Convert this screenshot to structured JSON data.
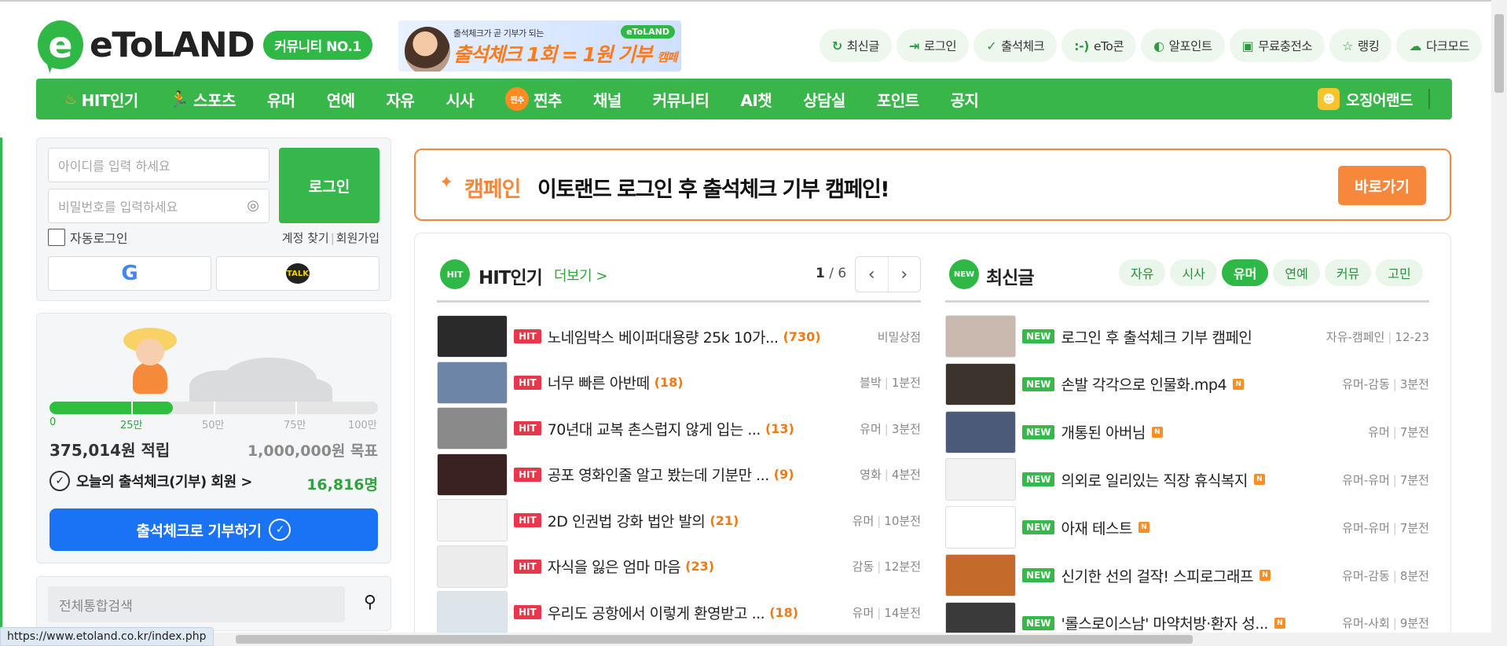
{
  "header": {
    "logo_mark": "e",
    "logo_text": "eToLAND",
    "badge": "커뮤니티 NO.1",
    "banner": {
      "sub": "출석체크가 곧 기부가 되는",
      "main_big": "출석체크 1회 = 1원 기부",
      "main_small": "캠페인",
      "tag": "eToLAND"
    },
    "quick_links": [
      {
        "icon": "refresh-icon",
        "glyph": "↻",
        "label": "최신글"
      },
      {
        "icon": "login-icon",
        "glyph": "⇥",
        "label": "로그인"
      },
      {
        "icon": "check-circle-icon",
        "glyph": "✓",
        "label": "출석체크"
      },
      {
        "icon": "eto-con-icon",
        "glyph": ":-)",
        "label": "eTo콘"
      },
      {
        "icon": "point-icon",
        "glyph": "◐",
        "label": "알포인트"
      },
      {
        "icon": "charge-station-icon",
        "glyph": "▣",
        "label": "무료충전소"
      },
      {
        "icon": "star-icon",
        "glyph": "☆",
        "label": "랭킹"
      },
      {
        "icon": "dark-mode-icon",
        "glyph": "☁",
        "label": "다크모드"
      }
    ]
  },
  "nav": {
    "items": [
      "HIT인기",
      "스포츠",
      "유머",
      "연예",
      "자유",
      "시사",
      "찐추",
      "채널",
      "커뮤니티",
      "AI챗",
      "상담실",
      "포인트",
      "공지"
    ],
    "chu_badge": "찐추",
    "right_label": "오징어랜드",
    "right_glyph": "☻"
  },
  "login": {
    "id_placeholder": "아이디를 입력 하세요",
    "pw_placeholder": "비밀번호를 입력하세요",
    "button": "로그인",
    "auto_login": "자동로그인",
    "find_account": "계정 찾기",
    "signup": "회원가입",
    "google_glyph": "G",
    "kakao_label": "TALK"
  },
  "donation": {
    "progress_fraction": 0.375,
    "tick_labels": [
      "0",
      "25만",
      "50만",
      "75만",
      "100만"
    ],
    "amount": "375,014원 적립",
    "goal": "1,000,000원 목표",
    "attendance_label": "오늘의 출석체크(기부) 회원 >",
    "attendance_count": "16,816명",
    "button": "출석체크로 기부하기"
  },
  "search": {
    "placeholder": "전체통합검색"
  },
  "campaign": {
    "label": "캠페인",
    "title": "이토랜드 로그인 후 출석체크 기부 캠페인!",
    "button": "바로가기"
  },
  "hit": {
    "icon_text": "HIT",
    "title": "HIT인기",
    "more": "더보기 >",
    "page_current": "1",
    "page_total": "/ 6",
    "badge": "HIT",
    "rows": [
      {
        "title": "노네임박스 베이퍼대용량 25k 10가...",
        "count": "(730)",
        "category": "비밀상점",
        "time": ""
      },
      {
        "title": "너무 빠른 아반떼",
        "count": "(18)",
        "category": "블박",
        "time": "1분전"
      },
      {
        "title": "70년대 교복 촌스럽지 않게 입는 ...",
        "count": "(13)",
        "category": "유머",
        "time": "3분전"
      },
      {
        "title": "공포 영화인줄 알고 봤는데 기분만 ...",
        "count": "(9)",
        "category": "영화",
        "time": "4분전"
      },
      {
        "title": "2D 인권법 강화 법안 발의",
        "count": "(21)",
        "category": "유머",
        "time": "10분전"
      },
      {
        "title": "자식을 잃은 엄마 마음",
        "count": "(23)",
        "category": "감동",
        "time": "12분전"
      },
      {
        "title": "우리도 공항에서 이렇게 환영받고 ...",
        "count": "(18)",
        "category": "유머",
        "time": "14분전"
      }
    ]
  },
  "latest": {
    "icon_text": "NEW",
    "title": "최신글",
    "tabs": [
      "자유",
      "시사",
      "유머",
      "연예",
      "커뮤",
      "고민"
    ],
    "active_tab": "유머",
    "badge": "NEW",
    "n_badge": "N",
    "rows": [
      {
        "title": "로그인 후 출석체크 기부 캠페인",
        "category": "자유-캠페인",
        "time": "12-23",
        "n": false
      },
      {
        "title": "손발 각각으로 인물화.mp4",
        "category": "유머-감동",
        "time": "3분전",
        "n": true
      },
      {
        "title": "개통된 아버님",
        "category": "유머",
        "time": "7분전",
        "n": true
      },
      {
        "title": "의외로 일리있는 직장 휴식복지",
        "category": "유머-유머",
        "time": "7분전",
        "n": true
      },
      {
        "title": "아재 테스트",
        "category": "유머-유머",
        "time": "7분전",
        "n": true
      },
      {
        "title": "신기한 선의 걸작! 스피로그래프",
        "category": "유머-감동",
        "time": "8분전",
        "n": true
      },
      {
        "title": "'롤스로이스남' 마약처방·환자 성...",
        "category": "유머-사회",
        "time": "9분전",
        "n": true
      }
    ]
  },
  "status_url": "https://www.etoland.co.kr/index.php"
}
